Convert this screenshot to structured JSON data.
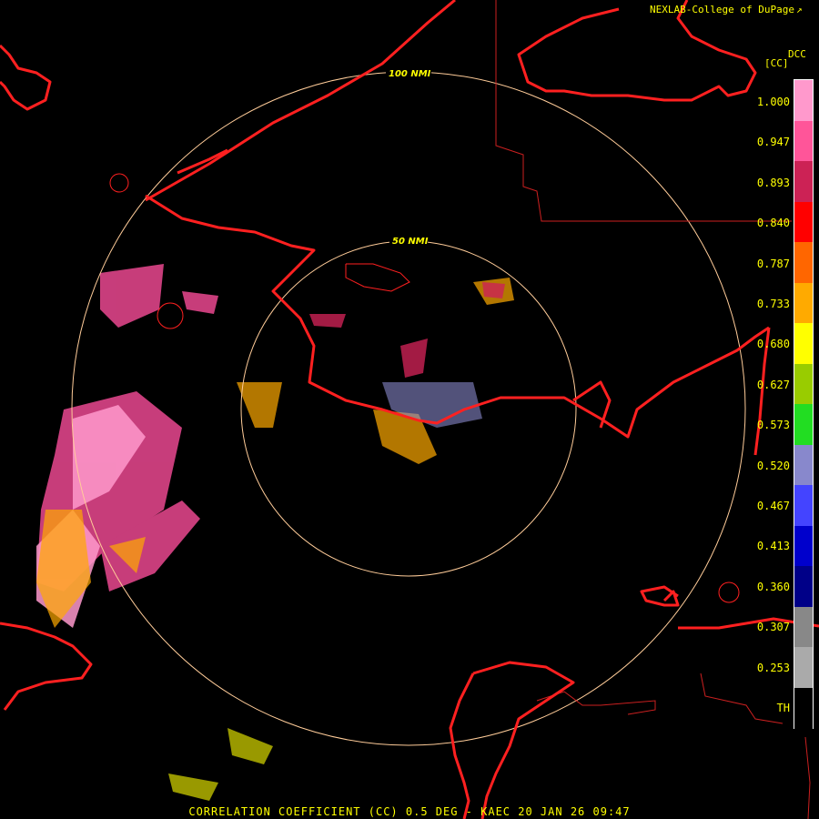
{
  "credit": "NEXLAB-College of DuPage",
  "credit_icon": "external-link-icon",
  "colorbar": {
    "product_code": "DCC",
    "unit": "[CC]",
    "ticks": [
      "1.000",
      "0.947",
      "0.893",
      "0.840",
      "0.787",
      "0.733",
      "0.680",
      "0.627",
      "0.573",
      "0.520",
      "0.467",
      "0.413",
      "0.360",
      "0.307",
      "0.253",
      "TH"
    ],
    "colors": [
      "#ff99cc",
      "#ff5599",
      "#cc2255",
      "#ff0000",
      "#ff6600",
      "#ffaa00",
      "#ffff00",
      "#99cc00",
      "#22dd22",
      "#8888cc",
      "#4444ff",
      "#0000cc",
      "#000088",
      "#888888",
      "#aaaaaa",
      "#000000"
    ]
  },
  "rings": [
    {
      "label": "50 NMI",
      "range_nmi": 50
    },
    {
      "label": "100 NMI",
      "range_nmi": 100
    }
  ],
  "map_colors": {
    "coastline": "#ff2020",
    "borders": "#cc2020",
    "rings": "#ffcc99"
  },
  "title": "CORRELATION COEFFICIENT (CC) 0.5 DEG - KAEC 20 JAN 26 09:47"
}
